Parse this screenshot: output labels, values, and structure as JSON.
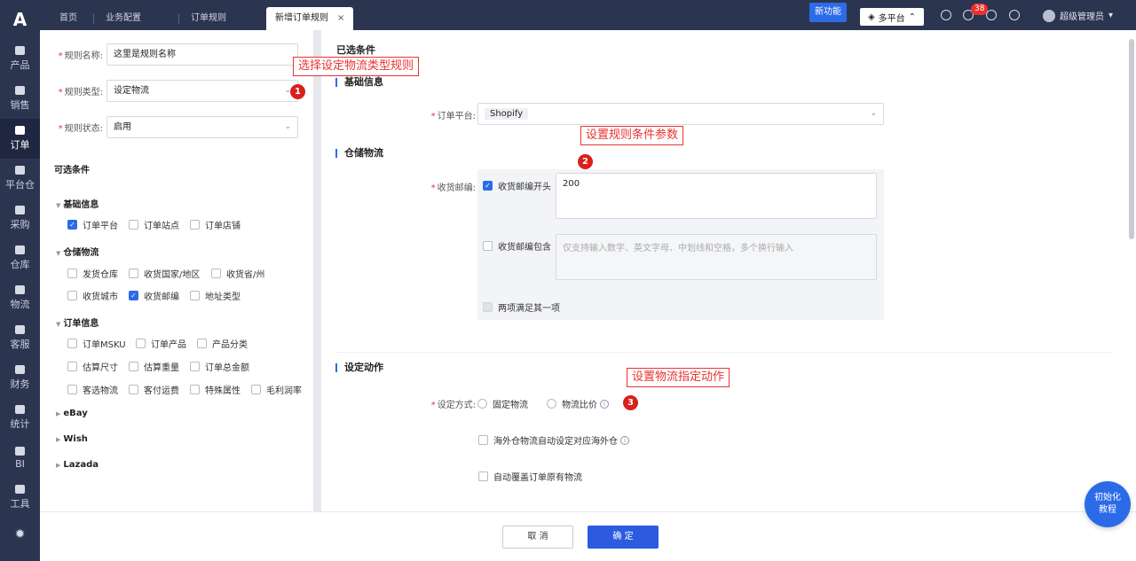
{
  "nav": {
    "logo": "A",
    "items": [
      {
        "label": "产品",
        "icon": "product-icon"
      },
      {
        "label": "销售",
        "icon": "sales-icon"
      },
      {
        "label": "订单",
        "icon": "order-icon"
      },
      {
        "label": "平台仓",
        "icon": "platform-warehouse-icon"
      },
      {
        "label": "采购",
        "icon": "cart-icon"
      },
      {
        "label": "仓库",
        "icon": "warehouse-icon"
      },
      {
        "label": "物流",
        "icon": "truck-icon"
      },
      {
        "label": "客服",
        "icon": "mail-icon"
      },
      {
        "label": "财务",
        "icon": "finance-icon"
      },
      {
        "label": "统计",
        "icon": "chart-icon"
      },
      {
        "label": "BI",
        "icon": "bi-icon"
      },
      {
        "label": "工具",
        "icon": "tools-icon"
      }
    ],
    "bottom_icon": "settings-icon"
  },
  "topbar": {
    "tabs": [
      "首页",
      "业务配置",
      "订单规则",
      "新增订单规则"
    ],
    "tab_close": "×",
    "new_feature": "新功能",
    "platform_label": "多平台",
    "notification_count": "38",
    "user_name": "超级管理员"
  },
  "left": {
    "rule_name_label": "规则名称:",
    "rule_name_value": "这里是规则名称",
    "rule_type_label": "规则类型:",
    "rule_type_value": "设定物流",
    "rule_status_label": "规则状态:",
    "rule_status_value": "启用",
    "optional_title": "可选条件",
    "groups": {
      "basic": {
        "title": "基础信息",
        "items": [
          "订单平台",
          "订单站点",
          "订单店铺"
        ]
      },
      "warehouse": {
        "title": "仓储物流",
        "items": [
          "发货仓库",
          "收货国家/地区",
          "收货省/州",
          "收货城市",
          "收货邮编",
          "地址类型"
        ]
      },
      "order": {
        "title": "订单信息",
        "items": [
          "订单MSKU",
          "订单产品",
          "产品分类",
          "估算尺寸",
          "估算重量",
          "订单总金额",
          "客选物流",
          "客付运费",
          "特殊属性",
          "毛利润率"
        ]
      },
      "ebay": "eBay",
      "wish": "Wish",
      "lazada": "Lazada"
    }
  },
  "main": {
    "selected_title": "已选条件",
    "basic_title": "基础信息",
    "platform_label": "订单平台:",
    "platform_tag": "Shopify",
    "warehouse_title": "仓储物流",
    "zip_label": "收货邮编:",
    "zip_start_label": "收货邮编开头",
    "zip_start_value": "200",
    "zip_contains_label": "收货邮编包含",
    "zip_contains_placeholder": "仅支持输入数字、英文字母、中划线和空格，多个换行输入",
    "either_label": "两项满足其一项",
    "action_title": "设定动作",
    "method_label": "设定方式:",
    "method_fixed": "固定物流",
    "method_compare": "物流比价",
    "overseas_label": "海外仓物流自动设定对应海外仓",
    "override_label": "自动覆盖订单原有物流"
  },
  "annotations": {
    "a1": "选择设定物流类型规则",
    "a2": "设置规则条件参数",
    "a3": "设置物流指定动作",
    "n1": "1",
    "n2": "2",
    "n3": "3"
  },
  "footer": {
    "cancel": "取 消",
    "confirm": "确 定"
  },
  "help_button": {
    "line1": "初始化",
    "line2": "教程"
  },
  "colors": {
    "nav_bg": "#2b3550",
    "primary": "#2c6be8",
    "annotation": "#e8322f"
  }
}
